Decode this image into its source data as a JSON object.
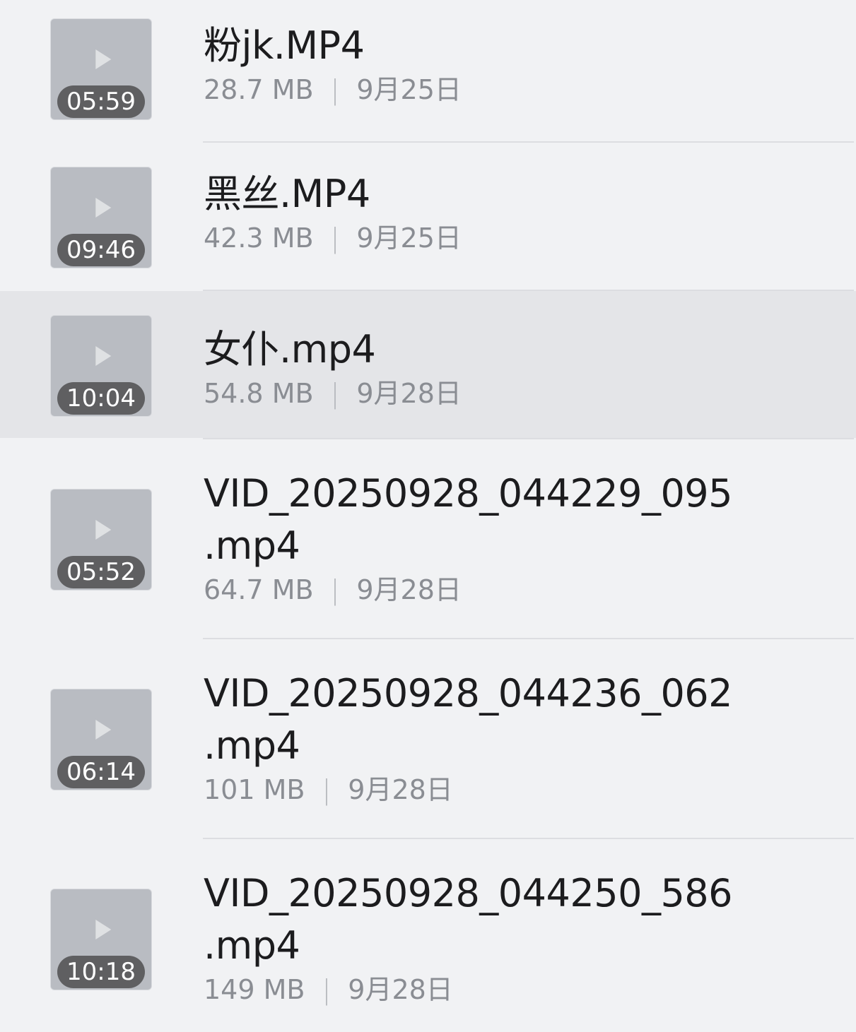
{
  "files": [
    {
      "name_lines": [
        "粉jk.MP4"
      ],
      "size": "28.7 MB",
      "date": "9月25日",
      "duration": "05:59",
      "selected": false
    },
    {
      "name_lines": [
        "黑丝.MP4"
      ],
      "size": "42.3 MB",
      "date": "9月25日",
      "duration": "09:46",
      "selected": false
    },
    {
      "name_lines": [
        "女仆.mp4"
      ],
      "size": "54.8 MB",
      "date": "9月28日",
      "duration": "10:04",
      "selected": true
    },
    {
      "name_lines": [
        "VID_20250928_044229_095",
        ".mp4"
      ],
      "size": "64.7 MB",
      "date": "9月28日",
      "duration": "05:52",
      "selected": false
    },
    {
      "name_lines": [
        "VID_20250928_044236_062",
        ".mp4"
      ],
      "size": "101 MB",
      "date": "9月28日",
      "duration": "06:14",
      "selected": false
    },
    {
      "name_lines": [
        "VID_20250928_044250_586",
        ".mp4"
      ],
      "size": "149 MB",
      "date": "9月28日",
      "duration": "10:18",
      "selected": false
    }
  ],
  "meta_separator": "|",
  "colors": {
    "background": "#f1f2f4",
    "selected_row": "#e4e5e8",
    "meta_text": "#8a8d93",
    "name_text": "#1c1c1e"
  },
  "icons": {
    "thumbnail": "video-thumbnail-placeholder"
  }
}
